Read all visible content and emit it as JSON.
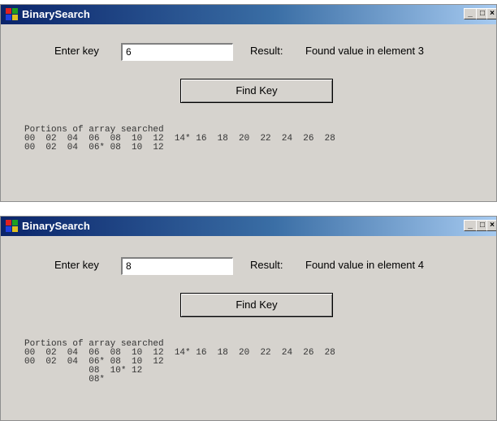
{
  "windows": [
    {
      "title": "BinarySearch",
      "controls": {
        "minimize": "_",
        "maximize": "□",
        "close": "×"
      },
      "enter_key_label": "Enter key",
      "key_value": "6",
      "result_label": "Result:",
      "result_text": "Found value in element 3",
      "find_button": "Find Key",
      "output_lines": [
        "Portions of array searched",
        "00  02  04  06  08  10  12  14* 16  18  20  22  24  26  28",
        "00  02  04  06* 08  10  12"
      ]
    },
    {
      "title": "BinarySearch",
      "controls": {
        "minimize": "_",
        "maximize": "□",
        "close": "×"
      },
      "enter_key_label": "Enter key",
      "key_value": "8",
      "result_label": "Result:",
      "result_text": "Found value in element 4",
      "find_button": "Find Key",
      "output_lines": [
        "Portions of array searched",
        "00  02  04  06  08  10  12  14* 16  18  20  22  24  26  28",
        "00  02  04  06* 08  10  12",
        "            08  10* 12",
        "            08*"
      ]
    }
  ],
  "colors": {
    "title_bar_start": "#0a246a",
    "title_bar_end": "#a6caf0",
    "window_face": "#d6d3ce"
  }
}
